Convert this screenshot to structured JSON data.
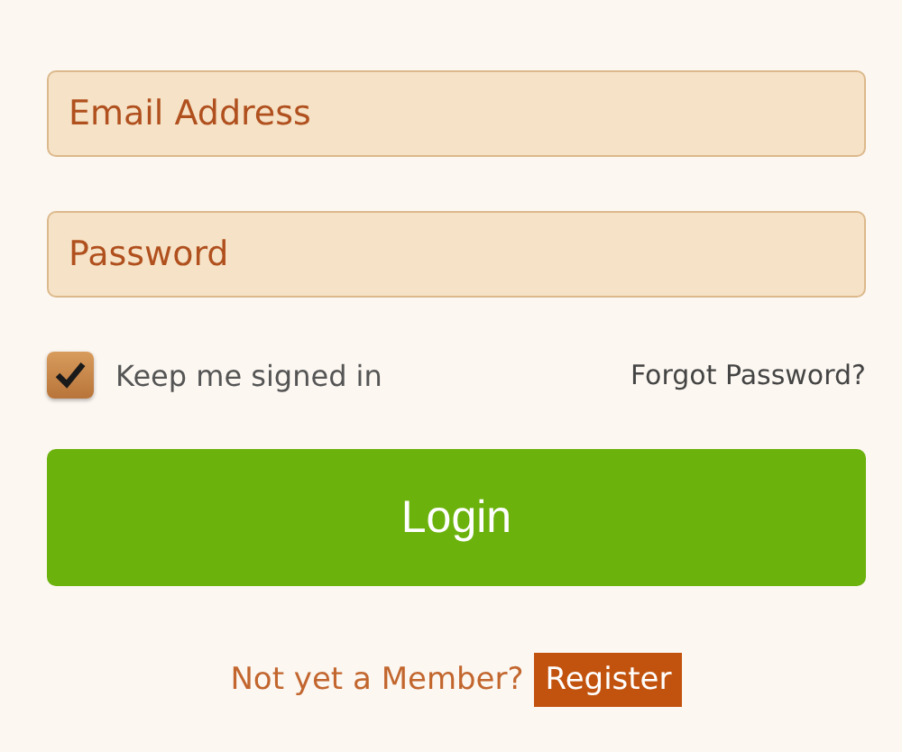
{
  "fields": [
    {
      "placeholder": "Email Address"
    },
    {
      "placeholder": "Password"
    }
  ],
  "remember": {
    "label": "Keep me signed in",
    "checked": true
  },
  "forgot_link": "Forgot Password?",
  "login_button": "Login",
  "signup": {
    "prompt": "Not yet a Member?",
    "button": "Register"
  }
}
